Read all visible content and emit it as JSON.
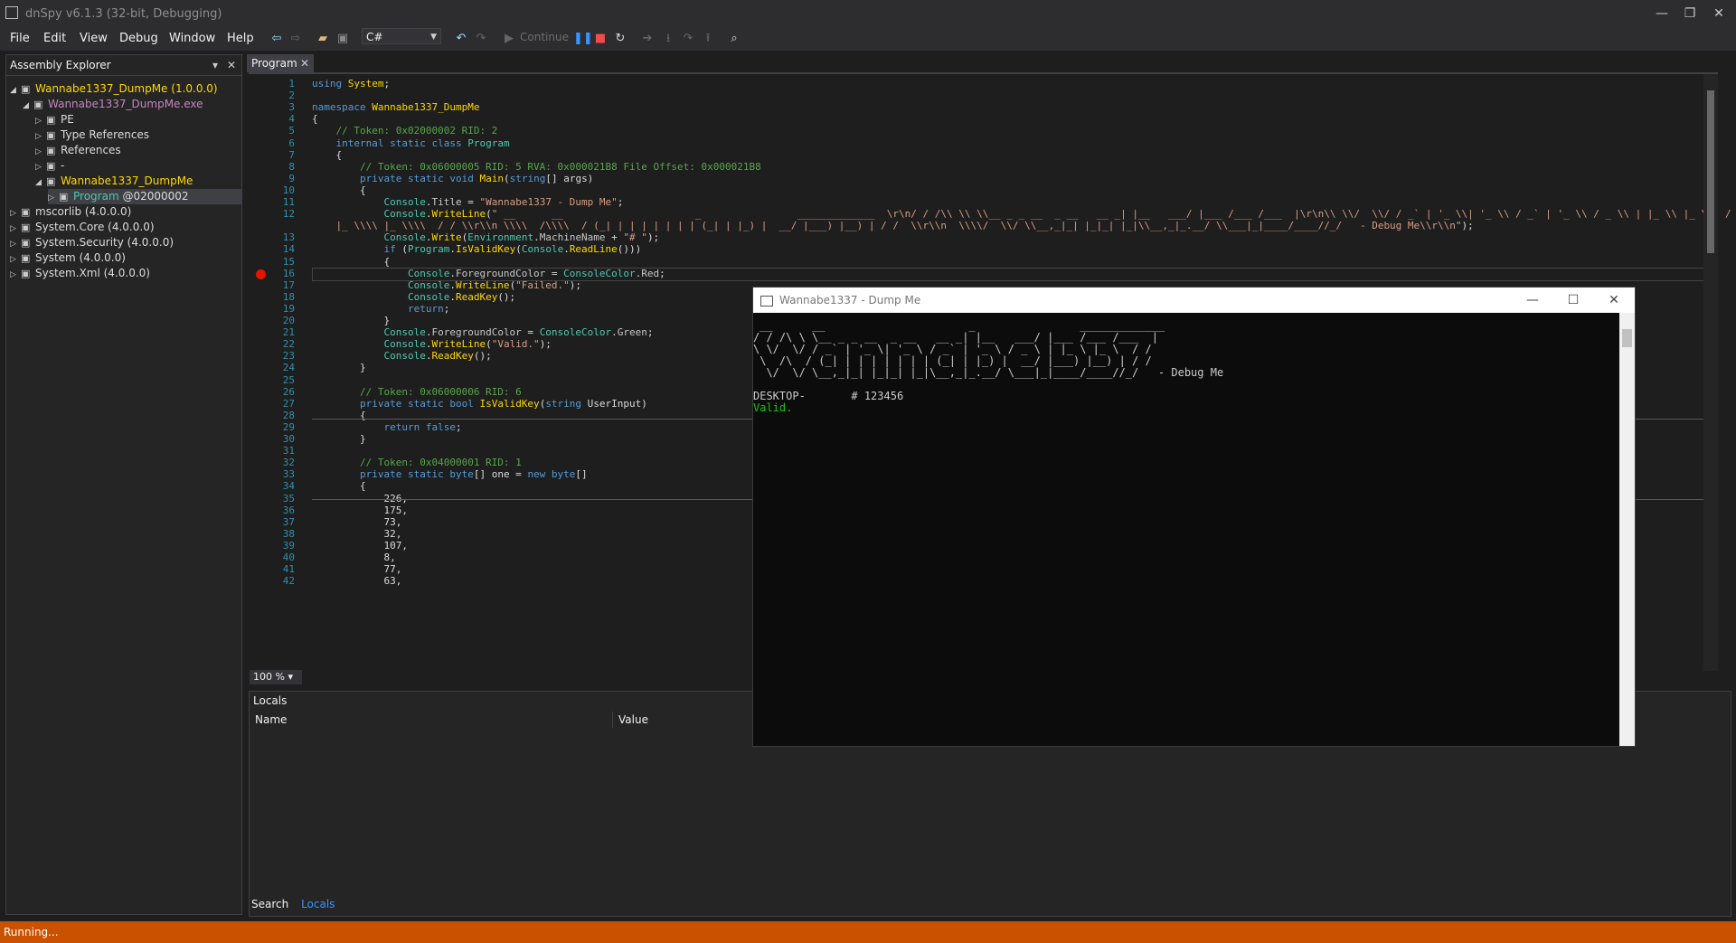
{
  "window": {
    "title": "dnSpy v6.1.3 (32-bit, Debugging)"
  },
  "menu": [
    "File",
    "Edit",
    "View",
    "Debug",
    "Window",
    "Help"
  ],
  "toolbar": {
    "language": "C#",
    "continue_label": "Continue"
  },
  "assembly_explorer": {
    "title": "Assembly Explorer",
    "items": [
      {
        "label": "Wannabe1337_DumpMe",
        "suffix": " (1.0.0.0)",
        "color": "#ffd700",
        "depth": 0,
        "exp": "◢"
      },
      {
        "label": "Wannabe1337_DumpMe.exe",
        "suffix": "",
        "color": "#c586c0",
        "depth": 1,
        "exp": "◢"
      },
      {
        "label": "PE",
        "suffix": "",
        "color": "#dcdcdc",
        "depth": 2,
        "exp": "▷"
      },
      {
        "label": "Type References",
        "suffix": "",
        "color": "#dcdcdc",
        "depth": 2,
        "exp": "▷"
      },
      {
        "label": "References",
        "suffix": "",
        "color": "#dcdcdc",
        "depth": 2,
        "exp": "▷"
      },
      {
        "label": "-",
        "suffix": "",
        "color": "#dcdcdc",
        "depth": 2,
        "exp": "▷"
      },
      {
        "label": "Wannabe1337_DumpMe",
        "suffix": "",
        "color": "#ffd700",
        "depth": 2,
        "exp": "◢"
      },
      {
        "label": "Program",
        "suffix": " @02000002",
        "color": "#4ec9b0",
        "depth": 3,
        "exp": "▷"
      },
      {
        "label": "mscorlib",
        "suffix": " (4.0.0.0)",
        "color": "#dcdcdc",
        "depth": 0,
        "exp": "▷"
      },
      {
        "label": "System.Core",
        "suffix": " (4.0.0.0)",
        "color": "#dcdcdc",
        "depth": 0,
        "exp": "▷"
      },
      {
        "label": "System.Security",
        "suffix": " (4.0.0.0)",
        "color": "#dcdcdc",
        "depth": 0,
        "exp": "▷"
      },
      {
        "label": "System",
        "suffix": " (4.0.0.0)",
        "color": "#dcdcdc",
        "depth": 0,
        "exp": "▷"
      },
      {
        "label": "System.Xml",
        "suffix": " (4.0.0.0)",
        "color": "#dcdcdc",
        "depth": 0,
        "exp": "▷"
      }
    ]
  },
  "editor": {
    "tab": "Program",
    "zoom": "100 %",
    "lines": [
      {
        "n": "1",
        "html": "<span class='kw'>using</span> <span class='ns'>System</span>;"
      },
      {
        "n": "2",
        "html": ""
      },
      {
        "n": "3",
        "html": "<span class='kw'>namespace</span> <span class='ns'>Wannabe1337_DumpMe</span>"
      },
      {
        "n": "4",
        "html": "{"
      },
      {
        "n": "5",
        "html": "    <span class='cm'>// Token: 0x02000002 RID: 2</span>"
      },
      {
        "n": "6",
        "html": "    <span class='kw'>internal static class</span> <span class='ty'>Program</span>"
      },
      {
        "n": "7",
        "html": "    {"
      },
      {
        "n": "8",
        "html": "        <span class='cm'>// Token: 0x06000005 RID: 5 RVA: 0x000021B8 File Offset: 0x000021B8</span>"
      },
      {
        "n": "9",
        "html": "        <span class='kw'>private static void</span> <span class='fn'>Main</span>(<span class='kw'>string</span>[] args)"
      },
      {
        "n": "10",
        "html": "        {"
      },
      {
        "n": "11",
        "html": "            <span class='ty'>Console</span>.<span class='prop'>Title</span> = <span class='str'>\"Wannabe1337 - Dump Me\"</span>;"
      },
      {
        "n": "12",
        "html": "            <span class='ty'>Console</span>.<span class='fn'>WriteLine</span>(<span class='str'>\" __      __                      _                _____________  \\r\\n/ / /\\\\ \\\\ \\\\__ _ _ __  _ __   __ _| |__   ___/ |___ /___ /___  |\\r\\n\\\\ \\\\/  \\\\/ / _` | '_ \\\\| '_ \\\\ / _` | '_ \\\\ / _ \\\\ | |_ \\\\ |_ \\\\  / /</span>"
      },
      {
        "n": "",
        "html": "<span class='str'>    |_ \\\\\\\\ |_ \\\\\\\\  / / \\\\r\\\\n \\\\\\\\  /\\\\\\\\  / (_| | | | | | | | (_| | |_) |  __/ |___) |__) | / /  \\\\r\\\\n  \\\\\\\\/  \\\\/ \\\\__,_|_| |_|_| |_|\\\\__,_|_.__/ \\\\___|_|____/____//_/   - Debug Me\\\\r\\\\n\"</span>);"
      },
      {
        "n": "13",
        "html": "            <span class='ty'>Console</span>.<span class='fn'>Write</span>(<span class='ty'>Environment</span>.<span class='prop'>MachineName</span> + <span class='str'>\"# \"</span>);"
      },
      {
        "n": "14",
        "html": "            <span class='kw'>if</span> (<span class='ty'>Program</span>.<span class='fn'>IsValidKey</span>(<span class='ty'>Console</span>.<span class='fn'>ReadLine</span>()))"
      },
      {
        "n": "15",
        "html": "            {"
      },
      {
        "n": "16",
        "html": "                <span class='ty'>Console</span>.<span class='prop'>ForegroundColor</span> = <span class='ty'>ConsoleColor</span>.<span class='prop'>Red</span>;"
      },
      {
        "n": "17",
        "html": "                <span class='ty'>Console</span>.<span class='fn'>WriteLine</span>(<span class='str'>\"Failed.\"</span>);"
      },
      {
        "n": "18",
        "html": "                <span class='ty'>Console</span>.<span class='fn'>ReadKey</span>();"
      },
      {
        "n": "19",
        "html": "                <span class='kw'>return</span>;"
      },
      {
        "n": "20",
        "html": "            }"
      },
      {
        "n": "21",
        "html": "            <span class='ty'>Console</span>.<span class='prop'>ForegroundColor</span> = <span class='ty'>ConsoleColor</span>.<span class='prop'>Green</span>;"
      },
      {
        "n": "22",
        "html": "            <span class='ty'>Console</span>.<span class='fn'>WriteLine</span>(<span class='str'>\"Valid.\"</span>);"
      },
      {
        "n": "23",
        "html": "            <span class='ty'>Console</span>.<span class='fn'>ReadKey</span>();"
      },
      {
        "n": "24",
        "html": "        }"
      },
      {
        "n": "25",
        "html": ""
      },
      {
        "n": "26",
        "html": "        <span class='cm'>// Token: 0x06000006 RID: 6</span>"
      },
      {
        "n": "27",
        "html": "        <span class='kw'>private static bool</span> <span class='fn'>IsValidKey</span>(<span class='kw'>string</span> UserInput)"
      },
      {
        "n": "28",
        "html": "        {"
      },
      {
        "n": "29",
        "html": "            <span class='kw'>return false</span>;"
      },
      {
        "n": "30",
        "html": "        }"
      },
      {
        "n": "31",
        "html": ""
      },
      {
        "n": "32",
        "html": "        <span class='cm'>// Token: 0x04000001 RID: 1</span>"
      },
      {
        "n": "33",
        "html": "        <span class='kw'>private static byte</span>[] one = <span class='kw'>new byte</span>[]"
      },
      {
        "n": "34",
        "html": "        {"
      },
      {
        "n": "35",
        "html": "            226,"
      },
      {
        "n": "36",
        "html": "            175,"
      },
      {
        "n": "37",
        "html": "            73,"
      },
      {
        "n": "38",
        "html": "            32,"
      },
      {
        "n": "39",
        "html": "            107,"
      },
      {
        "n": "40",
        "html": "            8,"
      },
      {
        "n": "41",
        "html": "            77,"
      },
      {
        "n": "42",
        "html": "            63,"
      }
    ]
  },
  "locals": {
    "title": "Locals",
    "col_name": "Name",
    "col_value": "Value"
  },
  "bottom_tabs": [
    "Search",
    "Locals"
  ],
  "console": {
    "title": "Wannabe1337 - Dump Me",
    "ascii": [
      " __      __                      _                _____________",
      "/ / /\\ \\ \\__ _ _ __  _ __   __ _| |__   ___/ |___ /___ /___  |",
      "\\ \\/  \\/ / _` | '_ \\| '_ \\ / _` | '_ \\ / _ \\ | |_ \\ |_ \\  / /",
      " \\  /\\  / (_| | | | | | | | (_| | |_) |  __/ |___) |__) | / /",
      "  \\/  \\/ \\__,_|_| |_|_| |_|\\__,_|_.__/ \\___|_|____/____//_/   - Debug Me"
    ],
    "prompt": "DESKTOP-       # 123456",
    "result": "Valid."
  },
  "status": "Running..."
}
